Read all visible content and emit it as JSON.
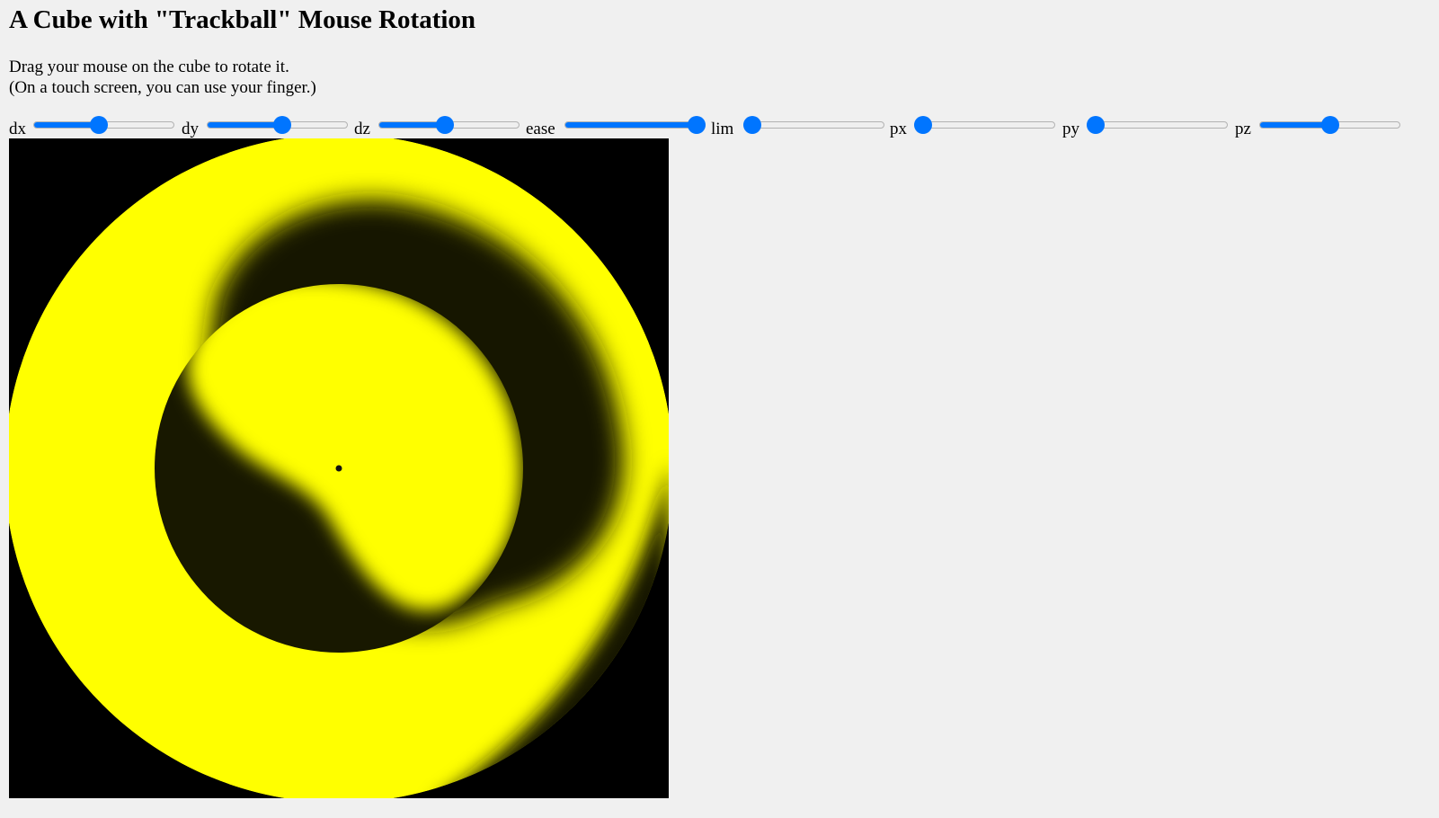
{
  "page": {
    "title": "A Cube with \"Trackball\" Mouse Rotation",
    "instructions": [
      "Drag your mouse on the cube to rotate it.",
      "(On a touch screen, you can use your finger.)"
    ]
  },
  "colors": {
    "page_background": "#f0f0f0",
    "slider_accent": "#0075ff",
    "canvas_background": "#000000",
    "cube_face": "#ffff00",
    "shadow": "#181800"
  },
  "sliders": [
    {
      "id": "dx",
      "label": "dx",
      "value_fraction": 0.46
    },
    {
      "id": "dy",
      "label": "dy",
      "value_fraction": 0.54
    },
    {
      "id": "dz",
      "label": "dz",
      "value_fraction": 0.47
    },
    {
      "id": "ease",
      "label": "ease",
      "value_fraction": 1.0
    },
    {
      "id": "lim",
      "label": "lim",
      "value_fraction": 0.0
    },
    {
      "id": "px",
      "label": "px",
      "value_fraction": 0.0
    },
    {
      "id": "py",
      "label": "py",
      "value_fraction": 0.0
    },
    {
      "id": "pz",
      "label": "pz",
      "value_fraction": 0.5
    }
  ]
}
